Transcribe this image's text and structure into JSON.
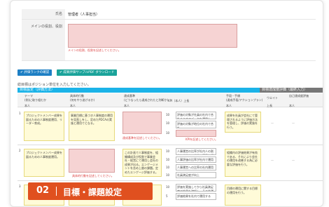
{
  "form": {
    "name_label": "氏名",
    "name_value": "管理者（人事担当）",
    "mission_label": "メインの役割、役割",
    "mission_error": "メインの役割、役割を記述してください。"
  },
  "buttons": {
    "check_rank": "評価ランクの確認",
    "download_sample": "成果評価サンプルPDF ダウンロード"
  },
  "note": "総目標はポジション単位を入力してください。",
  "table": {
    "band_label": "目標設定（評価方法）",
    "band_right": "目標達成度評価（最終入力）",
    "headers": [
      "テーマ",
      "具体的行動",
      "達成基準",
      "KPI（本人）上長",
      "手段・手順",
      "ウエイト",
      "自己達成度評価"
    ],
    "subheaders": [
      "本人",
      "本人",
      "本人",
      "本人",
      "本人",
      "本人",
      "上長",
      "本人"
    ],
    "header_notes": [
      "(例)に取り組むか",
      "(何をやり遂げるか)",
      "(どうなったら達成されたと判断か)",
      "",
      "(達成手段/アクションプラン)"
    ],
    "rows": [
      {
        "num": "1",
        "theme": "プロジェクトメンバー成果を図るための人事制度運用、リーダー育成。",
        "action": "事業目標に基づき人事制度の運用を見直しをし、定めたPDCAの実施と運用でとなる。",
        "criteria_error": "達成基準を記述してください。",
        "kpi": [
          "評価の対象が社員の社内で合計まとめてデータを運用し、",
          "評価の対象が地位の社内で合計",
          "KPIを記述してください。"
        ],
        "kpi_nums": [
          "10",
          "10",
          "10"
        ],
        "means": "成果を社員が会社にて管理されるように評価方法を管理し、評価の実施を行う。"
      },
      {
        "num": "2",
        "theme": "プロジェクトメンバー成果を図るための人事制度運用。",
        "action": "",
        "action_error": "具体的行動を記述してください。",
        "criteria": "この計画で人事制度を、組織構成及び役割で事業会社・経営にて運用し会社の成果が出る。エンゲージメントを含め上層の課題。定めたエンゲージ評価する。",
        "kpi": [
          "人事運営の比率が社内人の割合を合計し、会社の運用を行う。",
          "人事評価の比率が社内で運用の",
          "人事運営への比率の社内運用",
          "社員満足度が向上"
        ],
        "kpi_nums": [
          "10",
          "10",
          "10",
          "10"
        ],
        "means": "組織内の評価結果が有効である、それにより会社の運用を改善する為に必要な評価を行う。"
      },
      {
        "num": "3",
        "theme": "",
        "action": "",
        "criteria": "",
        "kpi": [
          "評価を実施してから社員満足度の結果を確認し、その後運用する。",
          "評価結果を社内で運用する"
        ],
        "kpi_nums": [
          "10",
          "5"
        ],
        "means": "目標の運用に関する目標の運用を行う。"
      }
    ],
    "dash": "—"
  },
  "banner": {
    "number": "02",
    "title": "目標・課題設定"
  },
  "colors": {
    "accent_blue": "#1bb3e8",
    "button_blue": "#1d7fc4",
    "button_teal": "#1aa39a",
    "banner_orange": "#e0501f",
    "error_pink": "#f6d3d3"
  }
}
